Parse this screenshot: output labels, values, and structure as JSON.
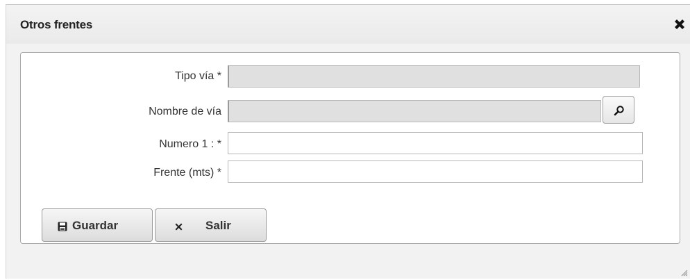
{
  "dialog": {
    "title": "Otros frentes",
    "close_icon": "close-icon"
  },
  "form": {
    "fields": [
      {
        "label": "Tipo vía  *",
        "value": "",
        "readonly": true
      },
      {
        "label": "Nombre de vía",
        "value": "",
        "readonly": true,
        "has_search": true
      },
      {
        "label": "Numero 1 :  *",
        "value": "",
        "readonly": false
      },
      {
        "label": "Frente (mts)  *",
        "value": "",
        "readonly": false
      }
    ],
    "search_icon": "search-icon"
  },
  "actions": {
    "save_label": "Guardar",
    "save_icon": "floppy-disk-icon",
    "exit_label": "Salir",
    "exit_icon": "close-icon"
  },
  "colors": {
    "readonly_bg": "#e0e0e0",
    "dialog_bg": "#f2f2f2",
    "button_gradient_top": "#f6f6f6",
    "button_gradient_bottom": "#dcdcdc"
  }
}
